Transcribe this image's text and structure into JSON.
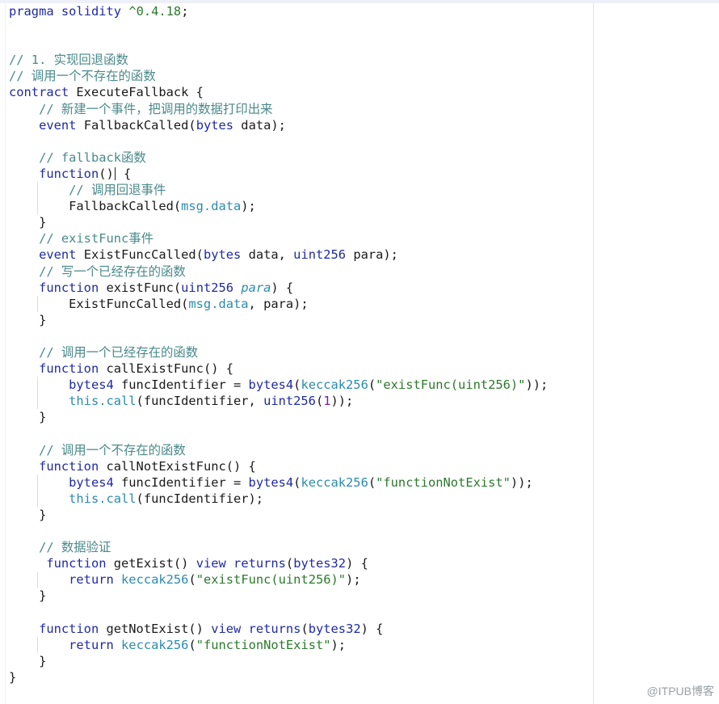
{
  "watermark": "@ITPUB博客",
  "lines": [
    [
      [
        "kw",
        "pragma"
      ],
      [
        "plain",
        " "
      ],
      [
        "kw",
        "solidity"
      ],
      [
        "plain",
        " "
      ],
      [
        "str",
        "^0.4.18"
      ],
      [
        "plain",
        ";"
      ]
    ],
    [],
    [],
    [
      [
        "cm",
        "// 1. 实现回退函数"
      ]
    ],
    [
      [
        "cm",
        "// 调用一个不存在的函数"
      ]
    ],
    [
      [
        "kw",
        "contract"
      ],
      [
        "plain",
        " ExecuteFallback {"
      ]
    ],
    [
      [
        "plain",
        "    "
      ],
      [
        "cm",
        "// 新建一个事件，把调用的数据打印出来"
      ]
    ],
    [
      [
        "plain",
        "    "
      ],
      [
        "kw",
        "event"
      ],
      [
        "plain",
        " FallbackCalled("
      ],
      [
        "ty",
        "bytes"
      ],
      [
        "plain",
        " data);"
      ]
    ],
    [],
    [
      [
        "plain",
        "    "
      ],
      [
        "cm",
        "// fallback函数"
      ]
    ],
    [
      [
        "plain",
        "    "
      ],
      [
        "kw",
        "function"
      ],
      [
        "plain",
        "()"
      ],
      [
        "caret",
        ""
      ],
      [
        "plain",
        " {"
      ]
    ],
    [
      [
        "plain",
        "        "
      ],
      [
        "cm",
        "// 调用回退事件"
      ]
    ],
    [
      [
        "plain",
        "        FallbackCalled("
      ],
      [
        "mem",
        "msg.data"
      ],
      [
        "plain",
        ");"
      ]
    ],
    [
      [
        "plain",
        "    }"
      ]
    ],
    [
      [
        "plain",
        "    "
      ],
      [
        "cm",
        "// existFunc事件"
      ]
    ],
    [
      [
        "plain",
        "    "
      ],
      [
        "kw",
        "event"
      ],
      [
        "plain",
        " ExistFuncCalled("
      ],
      [
        "ty",
        "bytes"
      ],
      [
        "plain",
        " data, "
      ],
      [
        "ty",
        "uint256"
      ],
      [
        "plain",
        " para);"
      ]
    ],
    [
      [
        "plain",
        "    "
      ],
      [
        "cm",
        "// 写一个已经存在的函数"
      ]
    ],
    [
      [
        "plain",
        "    "
      ],
      [
        "kw",
        "function"
      ],
      [
        "plain",
        " existFunc("
      ],
      [
        "ty",
        "uint256"
      ],
      [
        "plain",
        " "
      ],
      [
        "ital",
        "para"
      ],
      [
        "plain",
        ") {"
      ]
    ],
    [
      [
        "plain",
        "        ExistFuncCalled("
      ],
      [
        "mem",
        "msg.data"
      ],
      [
        "plain",
        ", para);"
      ]
    ],
    [
      [
        "plain",
        "    }"
      ]
    ],
    [],
    [
      [
        "plain",
        "    "
      ],
      [
        "cm",
        "// 调用一个已经存在的函数"
      ]
    ],
    [
      [
        "plain",
        "    "
      ],
      [
        "kw",
        "function"
      ],
      [
        "plain",
        " callExistFunc() {"
      ]
    ],
    [
      [
        "plain",
        "        "
      ],
      [
        "ty",
        "bytes4"
      ],
      [
        "plain",
        " funcIdentifier = "
      ],
      [
        "ty",
        "bytes4"
      ],
      [
        "plain",
        "("
      ],
      [
        "mem",
        "keccak256"
      ],
      [
        "plain",
        "("
      ],
      [
        "str",
        "\"existFunc(uint256)\""
      ],
      [
        "plain",
        "));"
      ]
    ],
    [
      [
        "plain",
        "        "
      ],
      [
        "mem",
        "this.call"
      ],
      [
        "plain",
        "(funcIdentifier, "
      ],
      [
        "ty",
        "uint256"
      ],
      [
        "plain",
        "("
      ],
      [
        "num",
        "1"
      ],
      [
        "plain",
        "));"
      ]
    ],
    [
      [
        "plain",
        "    }"
      ]
    ],
    [],
    [
      [
        "plain",
        "    "
      ],
      [
        "cm",
        "// 调用一个不存在的函数"
      ]
    ],
    [
      [
        "plain",
        "    "
      ],
      [
        "kw",
        "function"
      ],
      [
        "plain",
        " callNotExistFunc() {"
      ]
    ],
    [
      [
        "plain",
        "        "
      ],
      [
        "ty",
        "bytes4"
      ],
      [
        "plain",
        " funcIdentifier = "
      ],
      [
        "ty",
        "bytes4"
      ],
      [
        "plain",
        "("
      ],
      [
        "mem",
        "keccak256"
      ],
      [
        "plain",
        "("
      ],
      [
        "str",
        "\"functionNotExist\""
      ],
      [
        "plain",
        "));"
      ]
    ],
    [
      [
        "plain",
        "        "
      ],
      [
        "mem",
        "this.call"
      ],
      [
        "plain",
        "(funcIdentifier);"
      ]
    ],
    [
      [
        "plain",
        "    }"
      ]
    ],
    [],
    [
      [
        "plain",
        "    "
      ],
      [
        "cm",
        "// 数据验证"
      ]
    ],
    [
      [
        "plain",
        "     "
      ],
      [
        "kw",
        "function"
      ],
      [
        "plain",
        " getExist() "
      ],
      [
        "kw",
        "view"
      ],
      [
        "plain",
        " "
      ],
      [
        "kw",
        "returns"
      ],
      [
        "plain",
        "("
      ],
      [
        "ty",
        "bytes32"
      ],
      [
        "plain",
        ") {"
      ]
    ],
    [
      [
        "plain",
        "        "
      ],
      [
        "kw",
        "return"
      ],
      [
        "plain",
        " "
      ],
      [
        "mem",
        "keccak256"
      ],
      [
        "plain",
        "("
      ],
      [
        "str",
        "\"existFunc(uint256)\""
      ],
      [
        "plain",
        ");"
      ]
    ],
    [
      [
        "plain",
        "    }"
      ]
    ],
    [],
    [
      [
        "plain",
        "    "
      ],
      [
        "kw",
        "function"
      ],
      [
        "plain",
        " getNotExist() "
      ],
      [
        "kw",
        "view"
      ],
      [
        "plain",
        " "
      ],
      [
        "kw",
        "returns"
      ],
      [
        "plain",
        "("
      ],
      [
        "ty",
        "bytes32"
      ],
      [
        "plain",
        ") {"
      ]
    ],
    [
      [
        "plain",
        "        "
      ],
      [
        "kw",
        "return"
      ],
      [
        "plain",
        " "
      ],
      [
        "mem",
        "keccak256"
      ],
      [
        "plain",
        "("
      ],
      [
        "str",
        "\"functionNotExist\""
      ],
      [
        "plain",
        ");"
      ]
    ],
    [
      [
        "plain",
        "    }"
      ]
    ],
    [
      [
        "plain",
        "}"
      ]
    ]
  ],
  "highlighted_line": 10
}
